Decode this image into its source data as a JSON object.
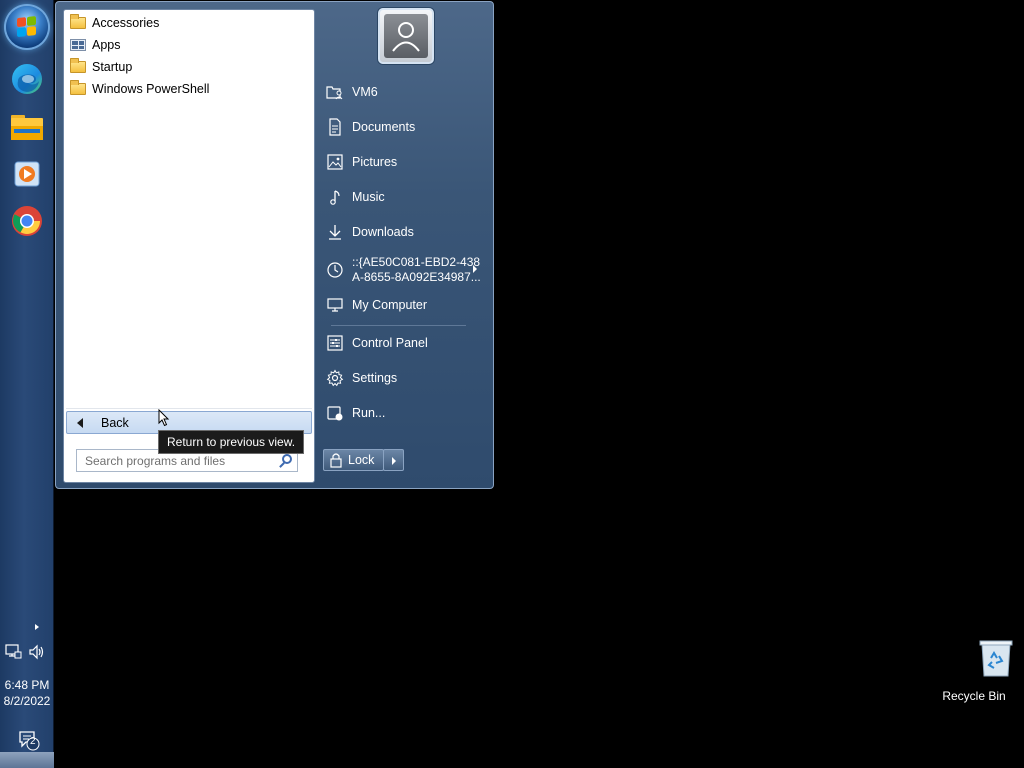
{
  "taskbar": {
    "pinned": [
      {
        "name": "edge-icon"
      },
      {
        "name": "file-explorer-icon"
      },
      {
        "name": "media-player-icon"
      },
      {
        "name": "chrome-icon"
      }
    ],
    "clock": {
      "time": "6:48 PM",
      "date": "8/2/2022"
    },
    "notifications": {
      "count": "2"
    }
  },
  "start_menu": {
    "folders": [
      {
        "label": "Accessories",
        "icon": "folder-icon"
      },
      {
        "label": "Apps",
        "icon": "apps-icon"
      },
      {
        "label": "Startup",
        "icon": "folder-icon"
      },
      {
        "label": "Windows PowerShell",
        "icon": "folder-icon"
      }
    ],
    "back_label": "Back",
    "back_tooltip": "Return to previous view.",
    "search_placeholder": "Search programs and files",
    "right_items": [
      {
        "label": "VM6",
        "icon": "user-folder-icon"
      },
      {
        "label": "Documents",
        "icon": "document-icon"
      },
      {
        "label": "Pictures",
        "icon": "picture-icon"
      },
      {
        "label": "Music",
        "icon": "music-icon"
      },
      {
        "label": "Downloads",
        "icon": "download-icon"
      },
      {
        "label_line1": "::{AE50C081-EBD2-438",
        "label_line2": "A-8655-8A092E34987...",
        "icon": "recent-icon"
      },
      {
        "label": "My Computer",
        "icon": "computer-icon"
      },
      {
        "label": "Control Panel",
        "icon": "control-panel-icon"
      },
      {
        "label": "Settings",
        "icon": "gear-icon"
      },
      {
        "label": "Run...",
        "icon": "run-icon"
      }
    ],
    "lock_label": "Lock"
  },
  "desktop": {
    "recycle_bin_label": "Recycle Bin"
  }
}
